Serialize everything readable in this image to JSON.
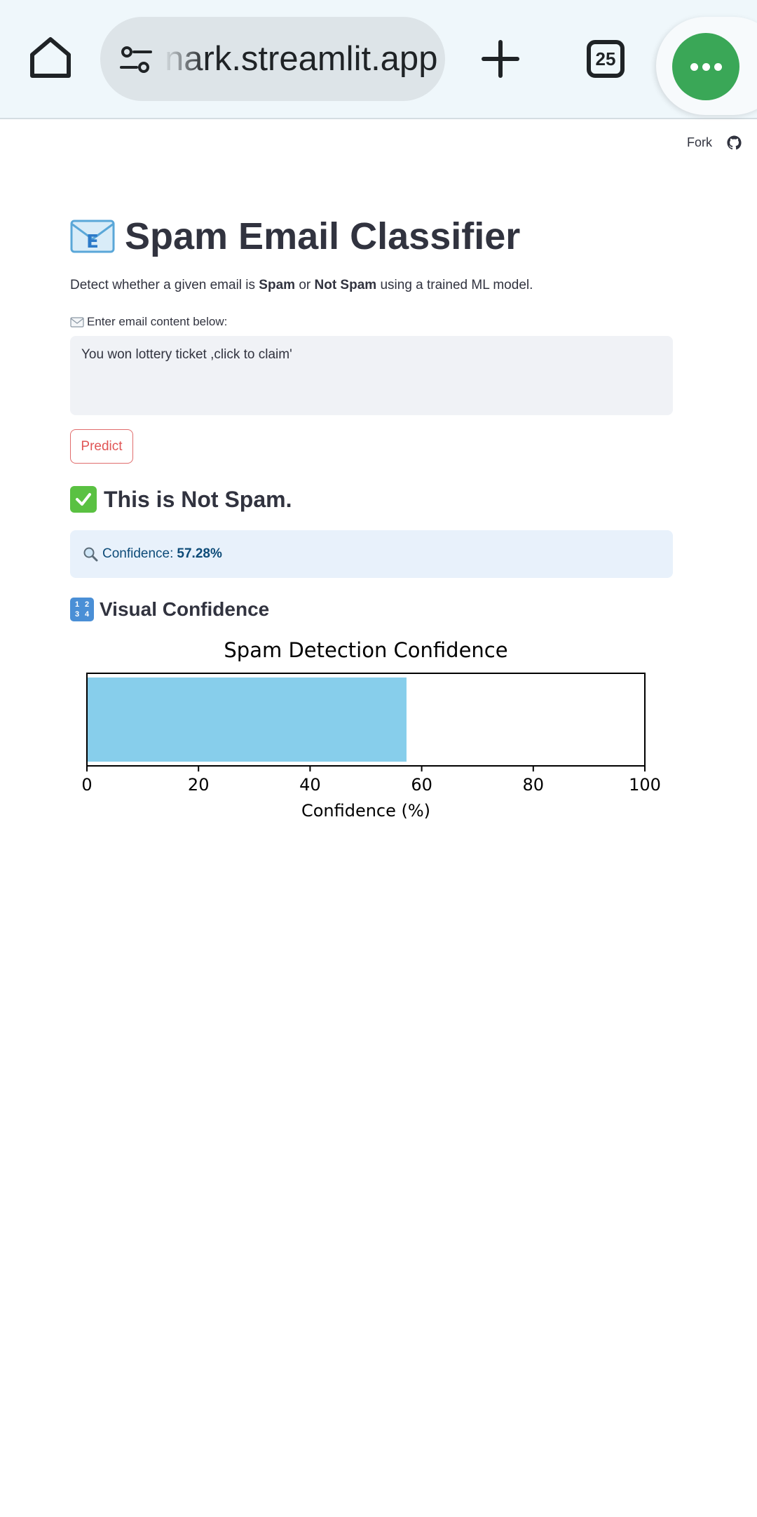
{
  "browser": {
    "url_visible": "nark.streamlit.app",
    "tab_count": "25"
  },
  "header": {
    "fork_label": "Fork"
  },
  "app": {
    "title": "Spam Email Classifier",
    "subtitle_pre": "Detect whether a given email is ",
    "subtitle_spam": "Spam",
    "subtitle_or": " or ",
    "subtitle_notspam": "Not Spam",
    "subtitle_post": " using a trained ML model.",
    "input_label": "Enter email content below:",
    "input_value": "You won lottery ticket ,click to claim'",
    "predict_label": "Predict",
    "result_text": "This is Not Spam.",
    "confidence_label": "Confidence:",
    "confidence_value": "57.28%",
    "visual_heading": "Visual Confidence"
  },
  "colors": {
    "accent_red": "#e05555",
    "bar_color": "#87ceeb",
    "info_bg": "#e8f1fb",
    "menu_green": "#3aa757"
  },
  "chart_data": {
    "type": "bar",
    "orientation": "horizontal",
    "title": "Spam Detection Confidence",
    "xlabel": "Confidence (%)",
    "ylabel": "",
    "xlim": [
      0,
      100
    ],
    "xticks": [
      0,
      20,
      40,
      60,
      80,
      100
    ],
    "values": [
      57.28
    ],
    "bar_color": "#87ceeb"
  }
}
